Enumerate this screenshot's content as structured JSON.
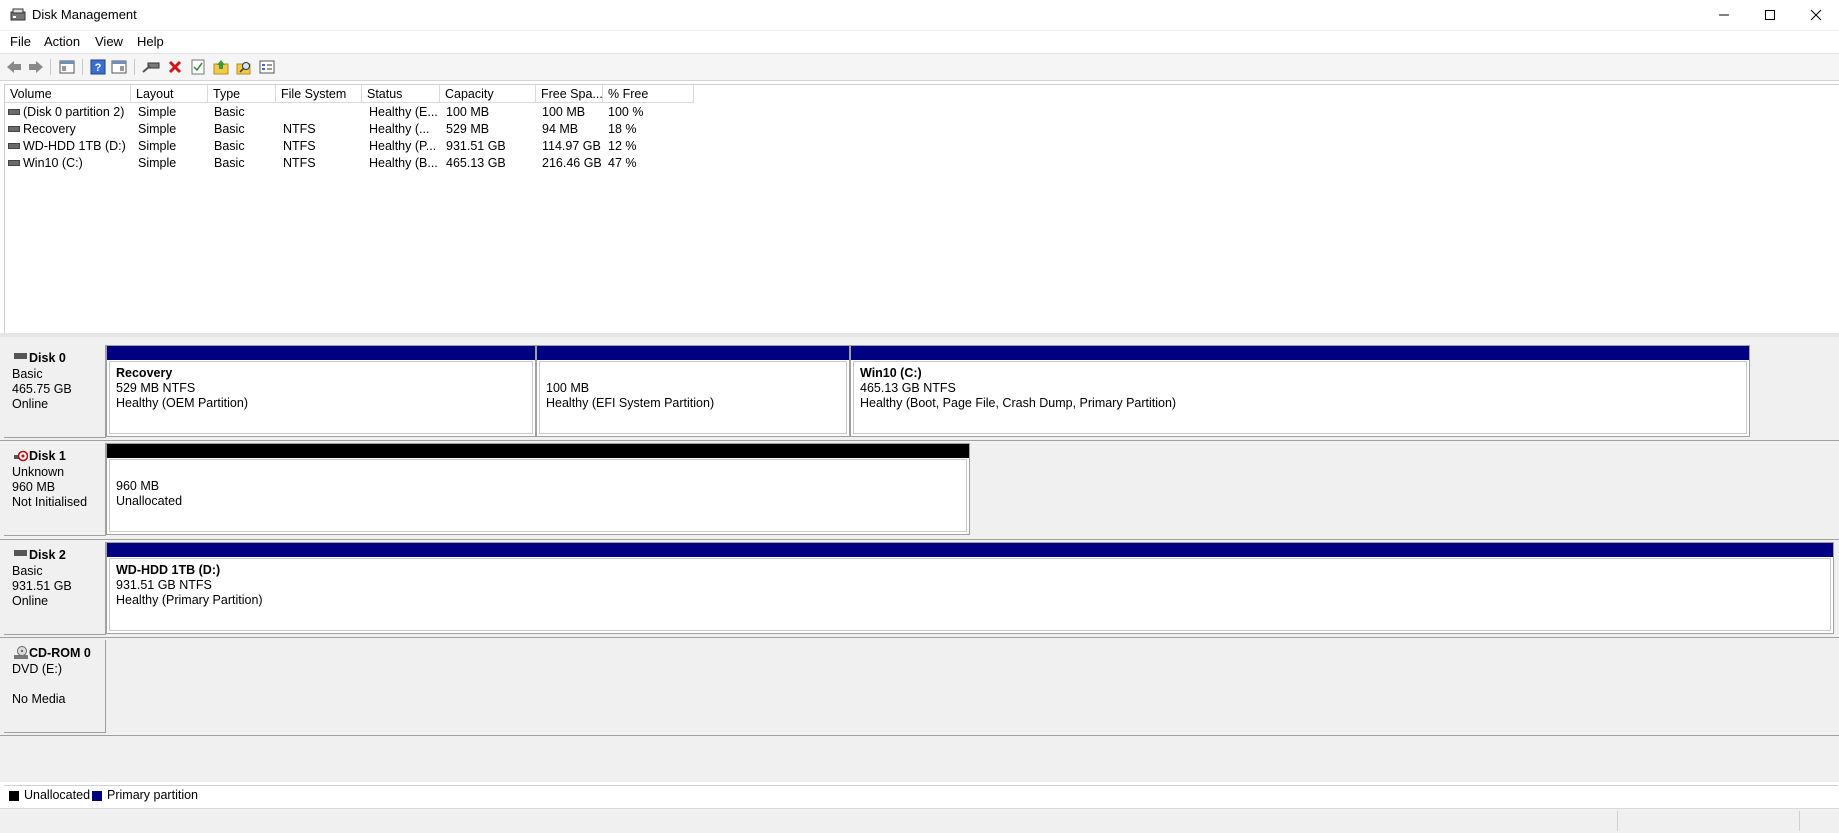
{
  "window": {
    "title": "Disk Management"
  },
  "menu": [
    "File",
    "Action",
    "View",
    "Help"
  ],
  "toolbar": {
    "icons": [
      "back-icon",
      "forward-icon",
      "show-hide-console-tree-icon",
      "help-icon",
      "properties-view-icon",
      "connect-drive-icon",
      "delete-icon",
      "check-icon",
      "folder-up-icon",
      "folder-search-icon",
      "settings-icon"
    ]
  },
  "volume_list": {
    "columns": [
      "Volume",
      "Layout",
      "Type",
      "File System",
      "Status",
      "Capacity",
      "Free Spa...",
      "% Free"
    ],
    "rows": [
      [
        "(Disk 0 partition 2)",
        "Simple",
        "Basic",
        "",
        "Healthy (E...",
        "100 MB",
        "100 MB",
        "100 %"
      ],
      [
        "Recovery",
        "Simple",
        "Basic",
        "NTFS",
        "Healthy (...",
        "529 MB",
        "94 MB",
        "18 %"
      ],
      [
        "WD-HDD 1TB (D:)",
        "Simple",
        "Basic",
        "NTFS",
        "Healthy (P...",
        "931.51 GB",
        "114.97 GB",
        "12 %"
      ],
      [
        "Win10 (C:)",
        "Simple",
        "Basic",
        "NTFS",
        "Healthy (B...",
        "465.13 GB",
        "216.46 GB",
        "47 %"
      ]
    ]
  },
  "disks": [
    {
      "name": "Disk 0",
      "type": "Basic",
      "size": "465.75 GB",
      "status": "Online",
      "partitions": [
        {
          "label": "Recovery",
          "size": "529 MB NTFS",
          "status": "Healthy (OEM Partition)"
        },
        {
          "label": "",
          "size": "100 MB",
          "status": "Healthy (EFI System Partition)"
        },
        {
          "label": "Win10  (C:)",
          "size": "465.13 GB NTFS",
          "status": "Healthy (Boot, Page File, Crash Dump, Primary Partition)"
        }
      ]
    },
    {
      "name": "Disk 1",
      "type": "Unknown",
      "size": "960 MB",
      "status": "Not Initialised",
      "partitions": [
        {
          "label": "",
          "size": "960 MB",
          "status": "Unallocated"
        }
      ]
    },
    {
      "name": "Disk 2",
      "type": "Basic",
      "size": "931.51 GB",
      "status": "Online",
      "partitions": [
        {
          "label": "WD-HDD 1TB  (D:)",
          "size": "931.51 GB NTFS",
          "status": "Healthy (Primary Partition)"
        }
      ]
    },
    {
      "name": "CD-ROM 0",
      "type": "DVD (E:)",
      "size": "",
      "status": "No Media",
      "partitions": []
    }
  ],
  "legend": [
    {
      "label": "Unallocated",
      "color": "#000000"
    },
    {
      "label": "Primary partition",
      "color": "#000080"
    }
  ],
  "colors": {
    "primary": "#000080",
    "unallocated": "#000000"
  }
}
